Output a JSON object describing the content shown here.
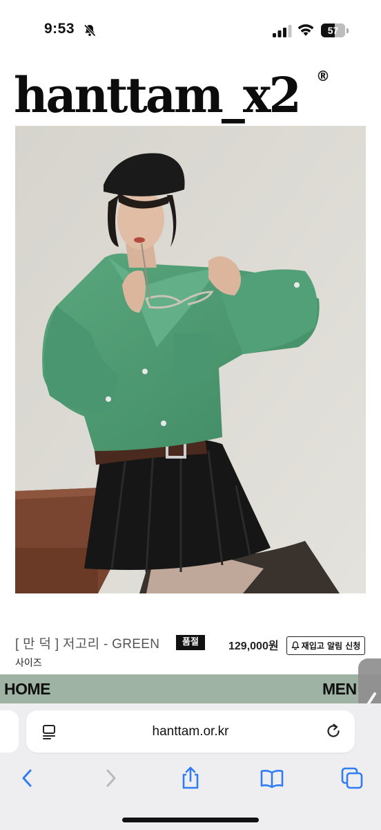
{
  "status_bar": {
    "time": "9:53",
    "battery_percent": 57,
    "battery_label": "57"
  },
  "brand": {
    "logo_text": "hanttam_x2",
    "registered_mark": "®"
  },
  "product": {
    "name": "[ 만 덕 ] 저고리 - GREEN",
    "soldout_badge": "품절",
    "price": "129,000원",
    "restock_button": "재입고 알림 신청",
    "size_label": "사이즈",
    "image_colors": {
      "shirt": "#4f9c73",
      "skirt": "#161616",
      "cap": "#1a1a1a",
      "wall": "#dcdad3",
      "table": "#7a4530"
    }
  },
  "nav": {
    "home": "HOME",
    "menu": "MEN",
    "background": "#9fb3a4"
  },
  "browser": {
    "url": "hanttam.or.kr",
    "back_enabled": true,
    "forward_enabled": false,
    "accent": "#2f7cf6"
  }
}
